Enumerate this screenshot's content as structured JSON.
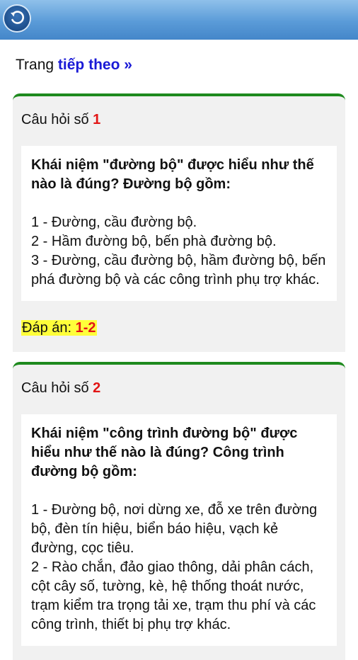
{
  "header": {
    "back_icon": "back-arrow-icon"
  },
  "nav": {
    "prefix": "Trang ",
    "next_link": "tiếp theo »"
  },
  "questions": [
    {
      "label": "Câu hỏi số ",
      "number": "1",
      "text": "Khái niệm \"đường bộ\" được hiểu như thế nào là đúng? Đường bộ gồm:",
      "options": [
        "1 - Đường, cầu đường bộ.",
        "2 - Hầm đường bộ, bến phà đường bộ.",
        "3 - Đường, cầu đường bộ, hầm đường bộ, bến phá đường bộ và các công trình phụ trợ khác."
      ],
      "answer_label": "Đáp án: ",
      "answer_value": "1-2"
    },
    {
      "label": "Câu hỏi số ",
      "number": "2",
      "text": "Khái niệm \"công trình đường bộ\" được hiểu như thế nào là đúng? Công trình đường bộ gồm:",
      "options": [
        "1 - Đường bộ, nơi dừng xe, đỗ xe trên đường bộ, đèn tín hiệu, biển báo hiệu, vạch kẻ đường, cọc tiêu.",
        "2 - Rào chắn, đảo giao thông, dải phân cách, cột cây số, tường, kè, hệ thống thoát nước, trạm kiểm tra trọng tải xe, trạm thu phí và các công trình, thiết bị phụ trợ khác."
      ]
    }
  ]
}
